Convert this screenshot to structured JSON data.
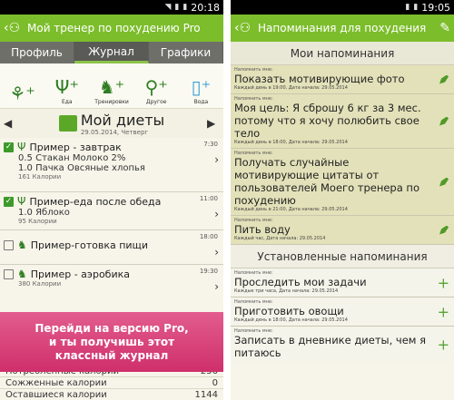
{
  "left": {
    "status": {
      "time": "20:18"
    },
    "title": "Мой тренер по похудению Pro",
    "tabs": [
      "Профиль",
      "Журнал",
      "Графики"
    ],
    "tools": [
      {
        "icon": "walker-plus-icon",
        "label": ""
      },
      {
        "icon": "fork-knife-plus-icon",
        "label": "Еда"
      },
      {
        "icon": "runner-plus-icon",
        "label": "Тренировки"
      },
      {
        "icon": "pin-plus-icon",
        "label": "Другое"
      },
      {
        "icon": "glass-plus-icon",
        "label": "Вода"
      }
    ],
    "date": {
      "title": "Мой диеты",
      "subtitle": "29.05.2014, Четверг"
    },
    "entries": [
      {
        "name": "Пример - завтрак",
        "time": "7:30",
        "checked": true,
        "icon": "fork-knife-icon",
        "lines": [
          "0.5 Стакан Молоко 2%",
          "1.0 Пачка Овсяные хлопья"
        ],
        "kcal": "161 Калории"
      },
      {
        "name": "Пример-еда после обеда",
        "time": "11:00",
        "checked": true,
        "icon": "fork-knife-icon",
        "lines": [
          "1.0 Яблоко"
        ],
        "kcal": "95 Калории"
      },
      {
        "name": "Пример-готовка пищи",
        "time": "18:00",
        "checked": false,
        "icon": "runner-icon",
        "lines": [],
        "kcal": ""
      },
      {
        "name": "Пример - аэробика",
        "time": "19:30",
        "checked": false,
        "icon": "runner-icon",
        "lines": [],
        "kcal": "380 Калории"
      }
    ],
    "promo": [
      "Перейди на версию Pro,",
      "и ты получишь этот",
      "классный журнал"
    ],
    "totals": [
      {
        "label": "Потребленные калории",
        "value": "256"
      },
      {
        "label": "Сожженные калории",
        "value": "0"
      },
      {
        "label": "Оставшиеся калории",
        "value": "1144"
      }
    ]
  },
  "right": {
    "status": {
      "time": "19:05"
    },
    "title": "Напоминания для похудения",
    "section_my": "Мои напоминания",
    "section_preset": "Установленные напоминания",
    "caption": "Напомнить мне:",
    "my": [
      {
        "text": "Показать мотивирующие фото",
        "meta": "Каждый день в 19:00, Дата начала: 29.05.2014"
      },
      {
        "text": "Моя цель: Я сброшу 6 кг за 3 мес. потому что я хочу полюбить свое тело",
        "meta": "Каждый день в 18:00, Дата начала: 29.05.2014"
      },
      {
        "text": "Получать случайные мотивирующие цитаты от пользователей Моего тренера по похудению",
        "meta": "Каждый день в 21:00, Дата начала: 29.05.2014"
      },
      {
        "text": "Пить воду",
        "meta": "Каждый час, Дата начала: 29.05.2014"
      }
    ],
    "preset": [
      {
        "text": "Проследить мои задачи",
        "meta": "Каждые три часа, Дата начала: 29.05.2014"
      },
      {
        "text": "Приготовить овощи",
        "meta": "Каждый день в 18:00, Дата начала: 29.05.2014"
      },
      {
        "text": "Записать в дневнике диеты, чем я питаюсь",
        "meta": ""
      }
    ]
  }
}
